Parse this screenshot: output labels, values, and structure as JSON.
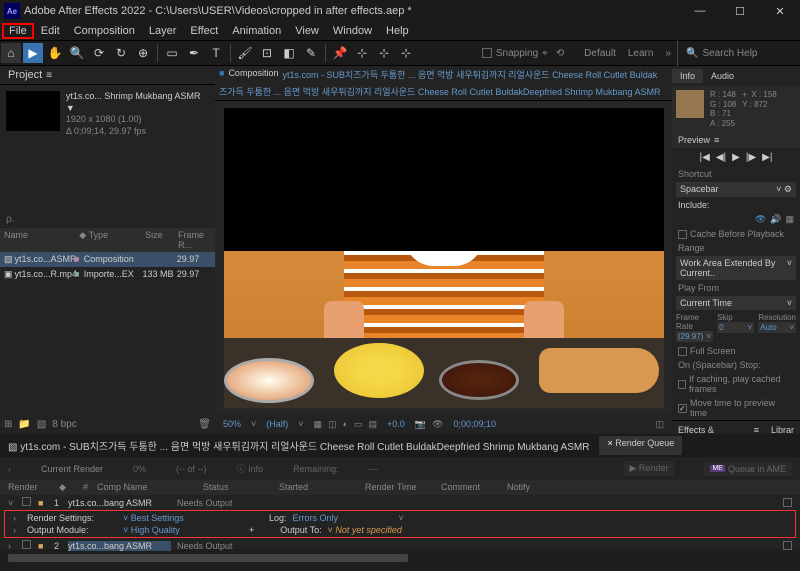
{
  "titlebar": {
    "icon_text": "Ae",
    "title": "Adobe After Effects 2022 - C:\\Users\\USER\\Videos\\cropped in after effects.aep *"
  },
  "menubar": {
    "items": [
      "File",
      "Edit",
      "Composition",
      "Layer",
      "Effect",
      "Animation",
      "View",
      "Window",
      "Help"
    ]
  },
  "toolbar": {
    "snapping": "Snapping",
    "default": "Default",
    "learn": "Learn",
    "search": "Search Help"
  },
  "project": {
    "tab": "Project",
    "asset": {
      "name": "yt1s.co... Shrimp Mukbang ASMR ▼",
      "res": "1920 x 1080 (1.00)",
      "dur": "Δ 0;09;14, 29.97 fps"
    },
    "search_placeholder": "ρ.",
    "cols": {
      "name": "Name",
      "type": "Type",
      "size": "Size",
      "fr": "Frame R..."
    },
    "items": [
      {
        "name": "yt1s.co...ASMR",
        "type": "Composition",
        "size": "",
        "fr": "29.97"
      },
      {
        "name": "yt1s.co...R.mp4",
        "type": "Importe...EX",
        "size": "133 MB",
        "fr": "29.97"
      }
    ],
    "footer_bpc": "8 bpc"
  },
  "comp": {
    "tabs_prefix": "Composition",
    "tabs_text": "yt1s.com - SUB치즈가득 두툼한 ... 음면 먹방 새우튀김까지 리얼사운드 Cheese Roll Cutlet Buldak",
    "bread": "즈가득 두툼한 ... 음면 먹방 새우튀김까지 리얼사운드 Cheese Roll Cutlet BuldakDeepfried Shrimp Mukbang ASMR",
    "zoom": "50%",
    "half": "(Half)",
    "plus": "+0.0",
    "time": "0;00;09;10"
  },
  "info": {
    "tabs": {
      "info": "Info",
      "audio": "Audio"
    },
    "rgb": {
      "r": "R : 148",
      "g": "G : 108",
      "b": "B : 71",
      "a": "A : 255"
    },
    "xy": {
      "x": "X : 158",
      "y": "Y : 872"
    }
  },
  "preview": {
    "title": "Preview",
    "shortcut_lbl": "Shortcut",
    "shortcut": "Spacebar",
    "include_lbl": "Include:",
    "cache": "Cache Before Playback",
    "range_lbl": "Range",
    "range": "Work Area Extended By Current..",
    "play_from_lbl": "Play From",
    "play_from": "Current Time",
    "fr_lbl": "Frame Rate",
    "skip_lbl": "Skip",
    "res_lbl": "Resolution",
    "fr": "(29.97)",
    "skip": "0",
    "res": "Auto",
    "fullscreen": "Full Screen",
    "spacebar_stop": "On (Spacebar) Stop:",
    "caching": "If caching, play cached frames",
    "move_time": "Move time to preview time"
  },
  "effects": {
    "tab1": "Effects & Presets",
    "tab2": "Librar"
  },
  "render": {
    "comp_tab": "yt1s.com - SUB치즈가득 두툼한 ... 음면 먹방 새우튀김까지 리얼사운드 Cheese Roll Cutlet BuldakDeepfried Shrimp Mukbang ASMR",
    "rq_tab": "Render Queue",
    "current": "Current Render",
    "pct": "0%",
    "of": "(-- of --)",
    "info_btn": "Info",
    "remaining": "Remaining:",
    "render_btn": "Render",
    "queue_btn": "Queue in AME",
    "cols": {
      "render": "Render",
      "num": "#",
      "comp": "Comp Name",
      "status": "Status",
      "started": "Started",
      "rtime": "Render Time",
      "comment": "Comment",
      "notify": "Notify"
    },
    "item": {
      "num": "1",
      "name": "yt1s.co...bang ASMR",
      "status": "Needs Output"
    },
    "rs_lbl": "Render Settings:",
    "rs_val": "Best Settings",
    "log_lbl": "Log:",
    "log_val": "Errors Only",
    "om_lbl": "Output Module:",
    "om_val": "High Quality",
    "out_lbl": "Output To:",
    "out_val": "Not yet specified",
    "item2": {
      "name": "yt1s.co...bang ASMR",
      "status": "Needs Output"
    }
  }
}
